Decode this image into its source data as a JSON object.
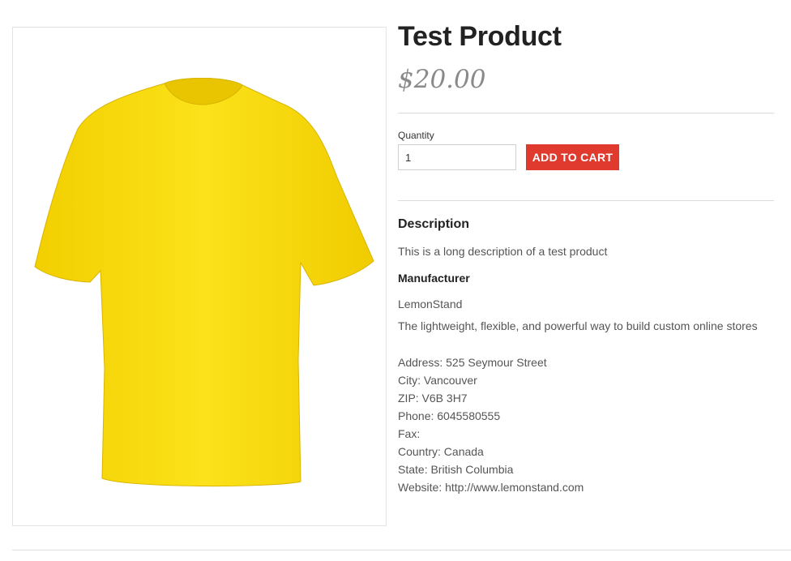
{
  "product": {
    "name": "Test Product",
    "price": "$20.00",
    "image_color": "#f4d90a"
  },
  "purchase": {
    "quantity_label": "Quantity",
    "quantity_value": "1",
    "add_to_cart_label": "ADD TO CART",
    "button_color": "#e03a2f"
  },
  "description": {
    "heading": "Description",
    "text": "This is a long description of a test product"
  },
  "manufacturer": {
    "heading": "Manufacturer",
    "name": "LemonStand",
    "tagline": "The lightweight, flexible, and powerful way to build custom online stores",
    "address": "Address: 525 Seymour Street",
    "city": "City: Vancouver",
    "zip": "ZIP: V6B 3H7",
    "phone": "Phone: 6045580555",
    "fax": "Fax:",
    "country": "Country: Canada",
    "state": "State: British Columbia",
    "website": "Website: http://www.lemonstand.com"
  }
}
